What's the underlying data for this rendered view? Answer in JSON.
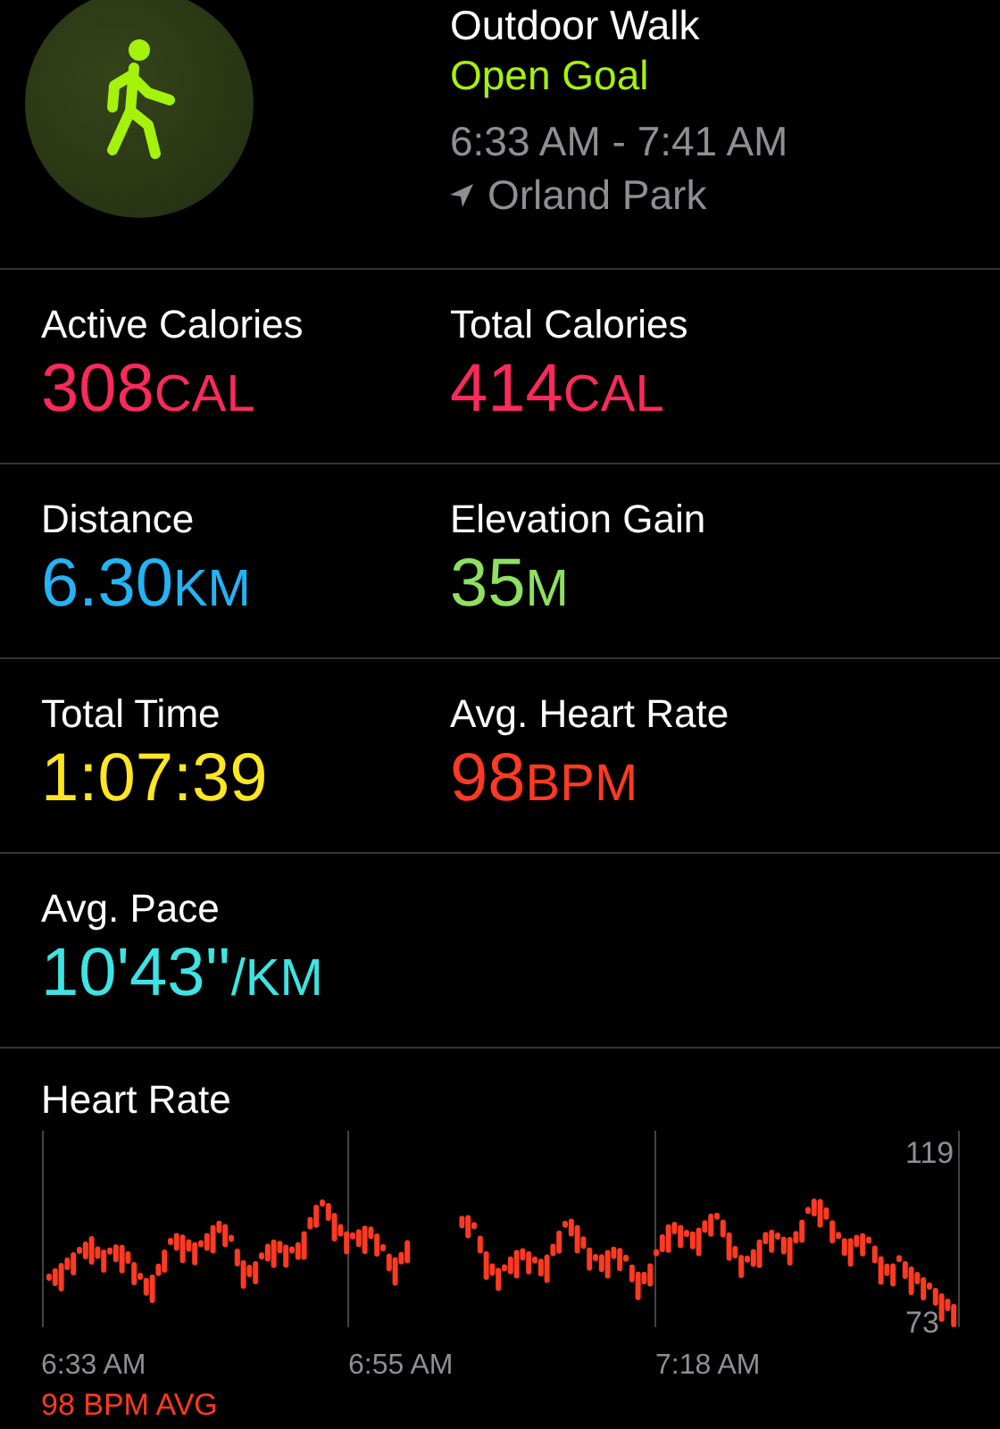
{
  "workout": {
    "title": "Outdoor Walk",
    "goal": "Open Goal",
    "time_range": "6:33 AM - 7:41 AM",
    "location": "Orland Park"
  },
  "stat_rows": [
    [
      {
        "label": "Active Calories",
        "value": "308",
        "unit": "CAL",
        "color": "#fa2a5a"
      },
      {
        "label": "Total Calories",
        "value": "414",
        "unit": "CAL",
        "color": "#fa2a5a"
      }
    ],
    [
      {
        "label": "Distance",
        "value": "6.30",
        "unit": "KM",
        "color": "#22b4f5"
      },
      {
        "label": "Elevation Gain",
        "value": "35",
        "unit": "M",
        "color": "#8fe060"
      }
    ],
    [
      {
        "label": "Total Time",
        "value": "1:07:39",
        "color": "#ffe620"
      },
      {
        "label": "Avg. Heart Rate",
        "value": "98",
        "unit": "BPM",
        "color": "#ff3a22"
      }
    ],
    [
      {
        "label": "Avg. Pace",
        "value": "10'43''",
        "unit": "/KM",
        "color": "#3ee3e3"
      }
    ]
  ],
  "heart_rate": {
    "title": "Heart Rate",
    "max_label": "119",
    "min_label": "73",
    "times": [
      "6:33 AM",
      "6:55 AM",
      "7:18 AM"
    ],
    "average": "98 BPM AVG"
  }
}
